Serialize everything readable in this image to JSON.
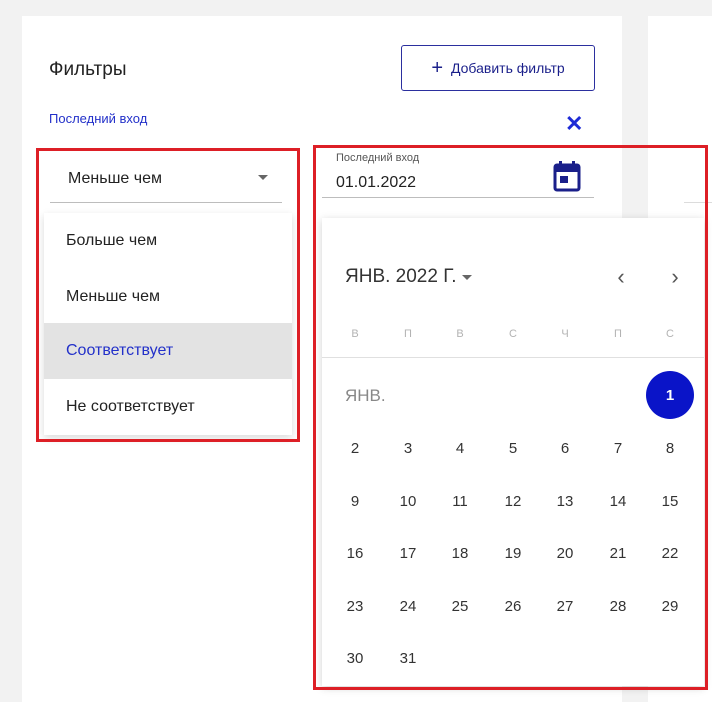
{
  "filters": {
    "title": "Фильтры",
    "add_button_label": "Добавить фильтр",
    "field_label": "Последний вход",
    "condition_value": "Меньше чем",
    "condition_options": [
      "Больше чем",
      "Меньше чем",
      "Соответствует",
      "Не соответствует"
    ],
    "condition_highlighted": "Соответствует",
    "date_field_label": "Последний вход",
    "date_value": "01.01.2022"
  },
  "calendar": {
    "month_year_label": "ЯНВ. 2022 Г.",
    "month_short": "ЯНВ.",
    "weekdays": [
      "В",
      "П",
      "В",
      "С",
      "Ч",
      "П",
      "С"
    ],
    "selected_day": "1",
    "weeks": [
      [
        "",
        "",
        "",
        "",
        "",
        "",
        "1"
      ],
      [
        "2",
        "3",
        "4",
        "5",
        "6",
        "7",
        "8"
      ],
      [
        "9",
        "10",
        "11",
        "12",
        "13",
        "14",
        "15"
      ],
      [
        "16",
        "17",
        "18",
        "19",
        "20",
        "21",
        "22"
      ],
      [
        "23",
        "24",
        "25",
        "26",
        "27",
        "28",
        "29"
      ],
      [
        "30",
        "31",
        "",
        "",
        "",
        "",
        ""
      ]
    ]
  },
  "icons": {
    "plus": "plus-icon",
    "close": "close-icon",
    "dropdown": "caret-down-icon",
    "calendar": "calendar-icon",
    "prev": "chevron-left-icon",
    "next": "chevron-right-icon"
  },
  "colors": {
    "accent": "#2230c9",
    "selected_day": "#0a14c8",
    "highlight_box": "#dd1f26",
    "selected_row_bg": "#e3e3e3"
  }
}
